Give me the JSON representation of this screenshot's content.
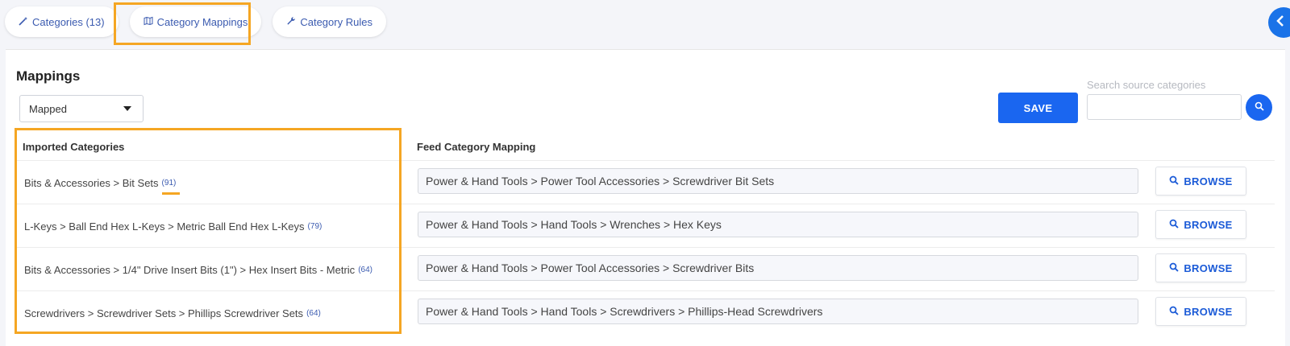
{
  "tabs": [
    {
      "label": "Categories (13)",
      "icon": "magic-wand-icon"
    },
    {
      "label": "Category Mappings",
      "icon": "map-icon"
    },
    {
      "label": "Category Rules",
      "icon": "wrench-icon"
    }
  ],
  "panel": {
    "title": "Mappings",
    "filter_value": "Mapped",
    "save_label": "SAVE",
    "search_placeholder": "Search source categories",
    "search_value": ""
  },
  "table": {
    "headers": {
      "imported": "Imported Categories",
      "feed": "Feed Category Mapping"
    },
    "browse_label": "BROWSE",
    "rows": [
      {
        "imported": "Bits & Accessories > Bit Sets",
        "count": "(91)",
        "mapping": "Power & Hand Tools > Power Tool Accessories > Screwdriver Bit Sets"
      },
      {
        "imported": "L-Keys > Ball End Hex L-Keys > Metric Ball End Hex L-Keys",
        "count": "(79)",
        "mapping": "Power & Hand Tools > Hand Tools > Wrenches > Hex Keys"
      },
      {
        "imported": "Bits & Accessories > 1/4\" Drive Insert Bits (1\") > Hex Insert Bits - Metric",
        "count": "(64)",
        "mapping": "Power & Hand Tools > Power Tool Accessories > Screwdriver Bits"
      },
      {
        "imported": "Screwdrivers > Screwdriver Sets > Phillips Screwdriver Sets",
        "count": "(64)",
        "mapping": "Power & Hand Tools > Hand Tools > Screwdrivers > Phillips-Head Screwdrivers"
      }
    ]
  },
  "colors": {
    "accent": "#1a66f0",
    "highlight": "#f5a623",
    "link": "#3b5bb0"
  }
}
